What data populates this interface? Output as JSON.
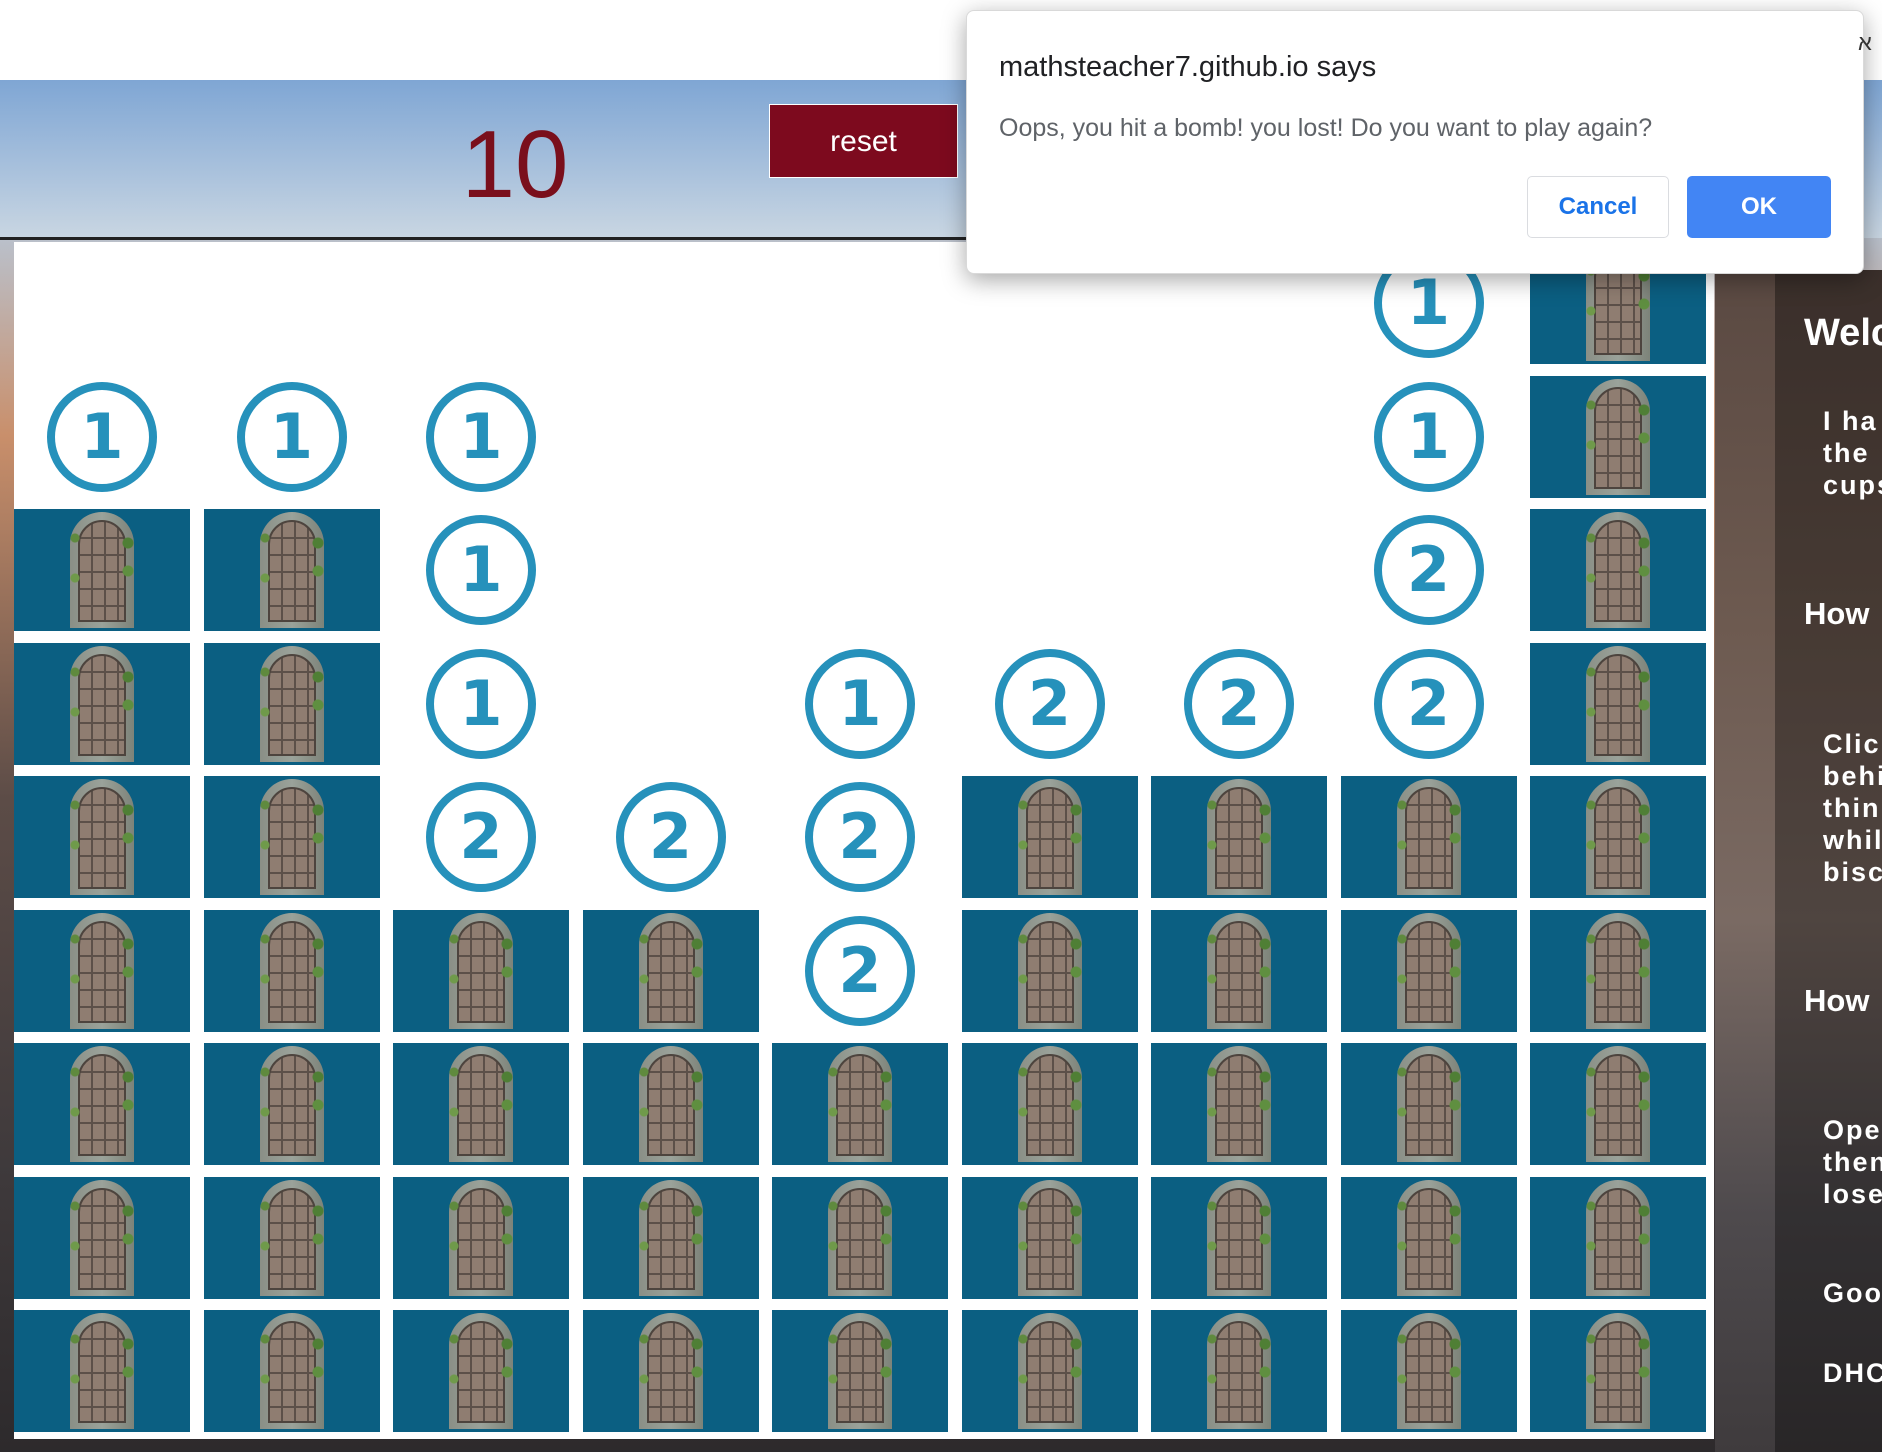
{
  "header": {
    "score": "10",
    "reset_label": "reset"
  },
  "dialog": {
    "title": "mathsteacher7.github.io says",
    "message": "Oops, you hit a bomb! you lost! Do you want to play again?",
    "cancel_label": "Cancel",
    "ok_label": "OK"
  },
  "corner_text": "א",
  "side_panel": {
    "items": [
      "Welc",
      "I ha\nthe\ncups",
      "How",
      "Clic\nbehi\nthin\nwhil\nbisc",
      "How",
      "Ope\nthen\nlose",
      "Goo",
      "DHC"
    ]
  },
  "board": {
    "columns": 9,
    "rows": 9,
    "grid": [
      [
        "",
        "",
        "",
        "",
        "",
        "",
        "",
        "1",
        "D"
      ],
      [
        "1",
        "1",
        "1",
        "",
        "",
        "",
        "",
        "1",
        "D"
      ],
      [
        "D",
        "D",
        "1",
        "",
        "",
        "",
        "",
        "2",
        "D"
      ],
      [
        "D",
        "D",
        "1",
        "",
        "1",
        "2",
        "2",
        "2",
        "D"
      ],
      [
        "D",
        "D",
        "2",
        "2",
        "2",
        "D",
        "D",
        "D",
        "D"
      ],
      [
        "D",
        "D",
        "D",
        "D",
        "2",
        "D",
        "D",
        "D",
        "D"
      ],
      [
        "D",
        "D",
        "D",
        "D",
        "D",
        "D",
        "D",
        "D",
        "D"
      ],
      [
        "D",
        "D",
        "D",
        "D",
        "D",
        "D",
        "D",
        "D",
        "D"
      ],
      [
        "D",
        "D",
        "D",
        "D",
        "D",
        "D",
        "D",
        "D",
        "D"
      ]
    ]
  },
  "colors": {
    "closed_cell": "#0b5f82",
    "number": "#2691bb",
    "score": "#7a0f1c",
    "reset_bg": "#7d0a1e",
    "ok_button": "#4285f4"
  }
}
